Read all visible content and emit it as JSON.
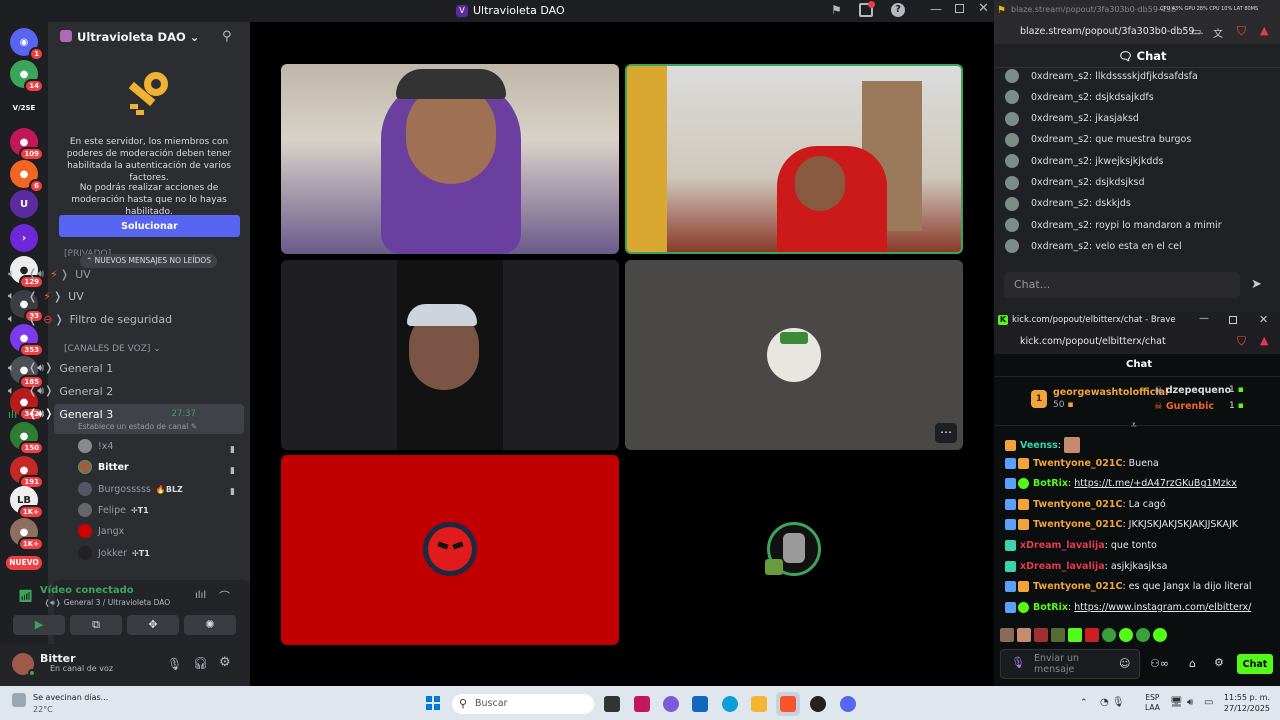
{
  "window": {
    "title": "Ultravioleta DAO"
  },
  "rail": {
    "servers": [
      {
        "name": "discord-home",
        "color": "#5865f2",
        "badge": "1",
        "glyph": "◉"
      },
      {
        "name": "server-green",
        "color": "#3ba55c",
        "badge": "14",
        "glyph": "●"
      },
      {
        "name": "server-text",
        "color": "#1e1f22",
        "badge": "",
        "glyph": "V/2SE"
      },
      {
        "name": "server-pink",
        "color": "#c2185b",
        "badge": "109",
        "glyph": "●"
      },
      {
        "name": "server-orange",
        "color": "#f26522",
        "badge": "6",
        "glyph": "●"
      },
      {
        "name": "server-uv",
        "color": "#5b2ca0",
        "badge": "",
        "glyph": "U"
      },
      {
        "name": "server-purple",
        "color": "#6d28d9",
        "badge": "",
        "glyph": "›"
      },
      {
        "name": "server-white",
        "color": "#ececec",
        "badge": "129",
        "glyph": "●"
      },
      {
        "name": "server-multi",
        "color": "#3a3d44",
        "badge": "33",
        "glyph": "●"
      },
      {
        "name": "server-violet",
        "color": "#7c3aed",
        "badge": "353",
        "glyph": "●"
      },
      {
        "name": "server-stack",
        "color": "#4e5058",
        "badge": "185",
        "glyph": "●"
      },
      {
        "name": "server-red",
        "color": "#b71c1c",
        "badge": "342",
        "glyph": "●"
      },
      {
        "name": "server-green2",
        "color": "#2e7d32",
        "badge": "150",
        "glyph": "●"
      },
      {
        "name": "server-mushroom",
        "color": "#c62828",
        "badge": "191",
        "glyph": "●"
      },
      {
        "name": "server-lb",
        "color": "#eeeeee",
        "badge": "1K+",
        "glyph": "LB"
      },
      {
        "name": "server-anime",
        "color": "#8d6e63",
        "badge": "1K+",
        "glyph": "●"
      }
    ],
    "new_label": "NUEVO"
  },
  "server": {
    "name": "Ultravioleta DAO",
    "notice_1": "En este servidor, los miembros con poderes de moderación deben tener habilitada la autenticación de varios factores.",
    "notice_2": "No podrás realizar acciones de moderación hasta que no lo hayas habilitado.",
    "fix_button": "Solucionar",
    "new_messages_pill": "NUEVOS MENSAJES NO LEÍDOS",
    "private_header": "PRIVADO",
    "text_channels": [
      {
        "label": "UV",
        "glyph": "⚡"
      },
      {
        "label": "UV",
        "glyph": "⚡"
      },
      {
        "label": "Filtro de seguridad",
        "glyph": "⊖"
      }
    ],
    "voice_header": "CANALES DE VOZ",
    "voice_channels": [
      {
        "label": "General 1"
      },
      {
        "label": "General 2"
      },
      {
        "label": "General 3",
        "timer": "27:37",
        "status": "Establece un estado de canal"
      }
    ],
    "members": [
      {
        "name": "!x4",
        "tag": "",
        "color": "#ffffff"
      },
      {
        "name": "Bitter",
        "tag": "",
        "color": "#ffffff"
      },
      {
        "name": "Burgosssss",
        "tag": "BLZ",
        "color": "#949ba4"
      },
      {
        "name": "Felipe",
        "tag": "T1",
        "color": "#949ba4"
      },
      {
        "name": "Jangx",
        "tag": "",
        "color": "#949ba4"
      },
      {
        "name": "Jokker",
        "tag": "T1",
        "color": "#949ba4"
      }
    ],
    "voice_panel": {
      "title": "Vídeo conectado",
      "subtitle": "General 3 / Ultravioleta DAO"
    },
    "user": {
      "name": "Bitter",
      "status": "En canal de voz"
    }
  },
  "blaze": {
    "tab_url": "blaze.stream/popout/3fa303b0-db59-43b",
    "url": "blaze.stream/popout/3fa303b0-db59...",
    "chat_title": "Chat",
    "messages": [
      "0xdream_s2: llkdsssskjdfjkdsafdsfa",
      "0xdream_s2: dsjkdsajkdfs",
      "0xdream_s2: jkasjaksd",
      "0xdream_s2: que muestra burgos",
      "0xdream_s2: jkwejksjkjkdds",
      "0xdream_s2: dsjkdsjksd",
      "0xdream_s2: dskkjds",
      "0xdream_s2: roypi lo mandaron a mimir",
      "0xdream_s2: velo esta en el cel"
    ],
    "input_placeholder": "Chat...",
    "stats": [
      "CPU 43%",
      "GPU 28%",
      "CPU 10%",
      "LAT 80MS"
    ]
  },
  "kick": {
    "window_title": "kick.com/popout/elbitterx/chat - Brave",
    "url": "kick.com/popout/elbitterx/chat",
    "chat_title": "Chat",
    "leaderboard": {
      "top": {
        "rank": "1",
        "name": "georgewashtolofficial",
        "score": "50"
      },
      "others": [
        {
          "name": "dzepequeno",
          "score": "1"
        },
        {
          "name": "Gurenbic",
          "score": "1"
        }
      ]
    },
    "messages": [
      {
        "user": "Veenss",
        "text": "",
        "color": "#3bd4ae"
      },
      {
        "user": "Twentyone_021C",
        "text": "Buena",
        "color": "#f2a33a"
      },
      {
        "user": "BotRix",
        "text": "https://t.me/+dA47rzGKuBg1Mzkx",
        "color": "#53fc18",
        "link": true
      },
      {
        "user": "Twentyone_021C",
        "text": "La cagó",
        "color": "#f2a33a"
      },
      {
        "user": "Twentyone_021C",
        "text": "JKKJSKJAKJSKJAKJJSKAJK",
        "color": "#f2a33a"
      },
      {
        "user": "xDream_lavalija",
        "text": "que tonto",
        "color": "#e53950"
      },
      {
        "user": "xDream_lavalija",
        "text": "asjkjkasjksa",
        "color": "#e53950"
      },
      {
        "user": "Twentyone_021C",
        "text": "es que Jangx la dijo literal",
        "color": "#f2a33a"
      },
      {
        "user": "BotRix",
        "text": "https://www.instagram.com/elbitterx/",
        "color": "#53fc18",
        "link": true
      }
    ],
    "input_placeholder": "Enviar un mensaje",
    "send_button": "Chat"
  },
  "taskbar": {
    "weather_text": "Se avecinan días...",
    "weather_temp": "22°C",
    "search_placeholder": "Buscar",
    "lang_1": "ESP",
    "lang_2": "LAA",
    "time": "11:55 p. m.",
    "date": "27/12/2025"
  },
  "colors": {
    "accent": "#5865f2",
    "kick_green": "#53fc18",
    "tile_red": "#c00000",
    "speaking": "#3ba55c"
  }
}
